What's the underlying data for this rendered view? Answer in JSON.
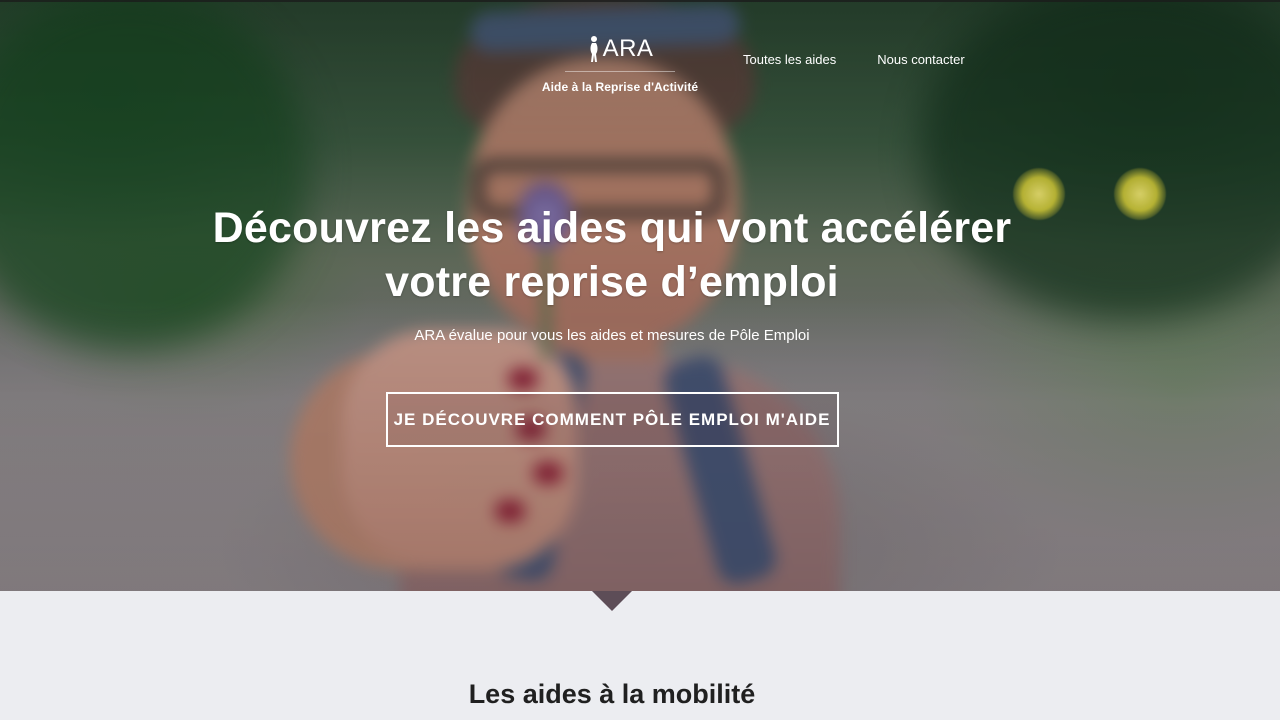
{
  "header": {
    "logo": {
      "text": "ARA",
      "icon": "woman-silhouette-icon"
    },
    "brand_subtitle": "Aide à la Reprise d'Activité",
    "nav": [
      {
        "label": "Toutes les aides"
      },
      {
        "label": "Nous contacter"
      }
    ]
  },
  "hero": {
    "title": "Découvrez les aides qui vont accélérer votre reprise d’emploi",
    "subtitle": "ARA évalue pour vous les aides et mesures de Pôle Emploi",
    "cta_label": "JE DÉCOUVRE COMMENT PÔLE EMPLOI M'AIDE",
    "background": "portrait-with-flower"
  },
  "section": {
    "title": "Les aides à la mobilité"
  },
  "colors": {
    "hero_overlay": "#4b2c33",
    "lower_bg": "#ecedf1",
    "notch": "#5d4d57",
    "text_light": "#ffffff",
    "text_dark": "#202020"
  }
}
